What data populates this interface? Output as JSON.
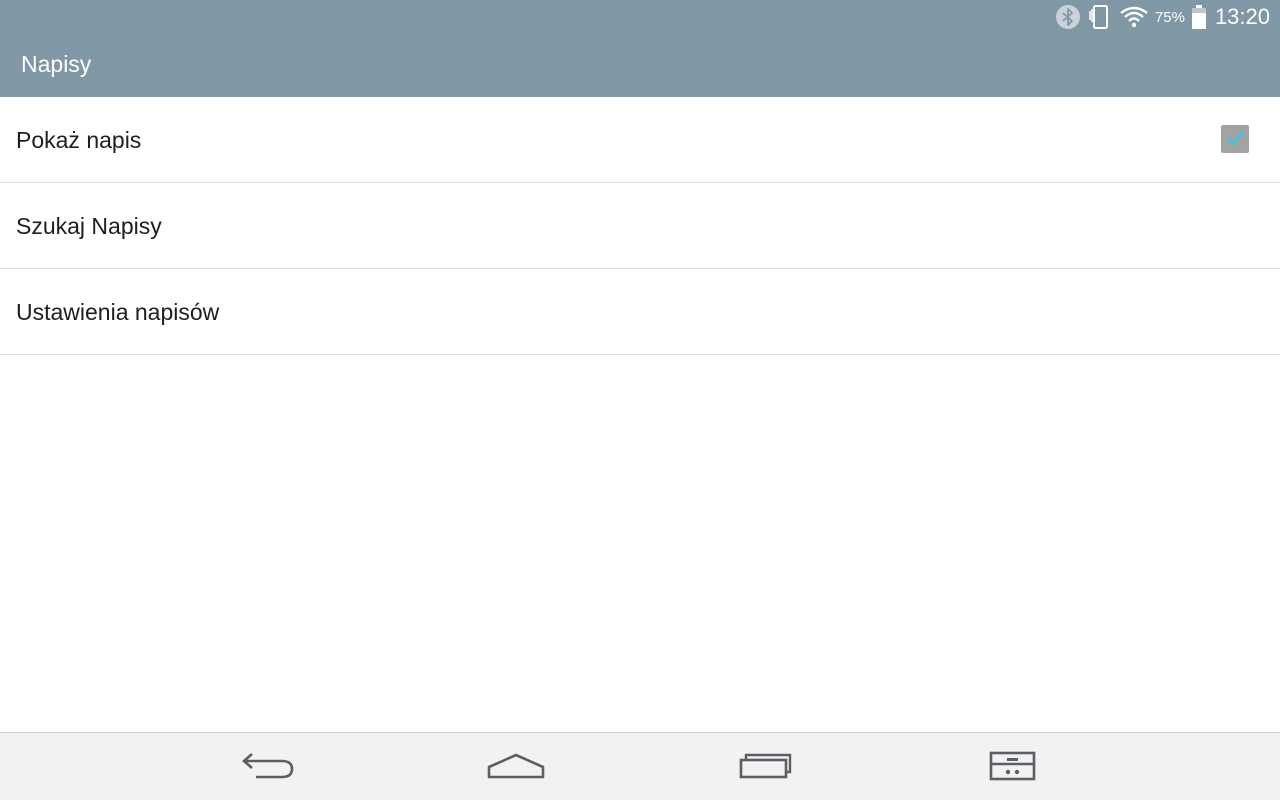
{
  "status_bar": {
    "battery_percent": "75%",
    "time": "13:20",
    "icons": [
      "bluetooth-icon",
      "vibrate-icon",
      "wifi-icon",
      "battery-icon"
    ]
  },
  "header": {
    "title": "Napisy"
  },
  "settings": {
    "items": [
      {
        "label": "Pokaż napis",
        "checked": true
      },
      {
        "label": "Szukaj Napisy"
      },
      {
        "label": "Ustawienia napisów"
      }
    ]
  },
  "nav_bar": {
    "icons": [
      "back-icon",
      "home-icon",
      "recent-apps-icon",
      "dual-window-icon"
    ]
  },
  "colors": {
    "header_bg": "#8098a6",
    "checkbox_bg": "#a3a3a3",
    "checkmark": "#34c8e4",
    "nav_bg": "#f2f2f2"
  }
}
